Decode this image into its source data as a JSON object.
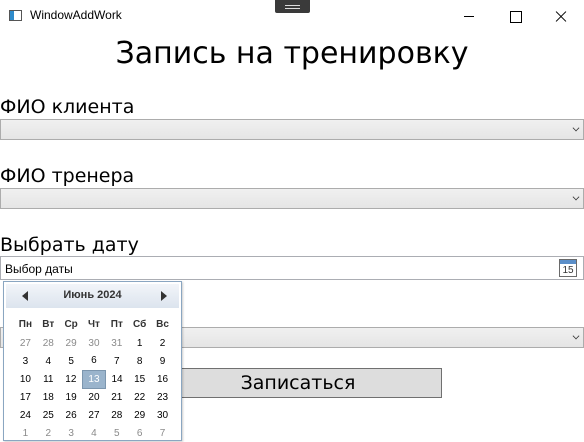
{
  "window": {
    "title": "WindowAddWork"
  },
  "page_title": "Запись на тренировку",
  "client": {
    "label": "ФИО клиента",
    "value": ""
  },
  "trainer": {
    "label": "ФИО тренера",
    "value": ""
  },
  "date": {
    "label": "Выбрать дату",
    "placeholder": "Выбор даты",
    "icon_text": "15"
  },
  "time": {
    "value": ""
  },
  "submit_label": "Записаться",
  "calendar": {
    "month": "Июнь 2024",
    "weekdays": [
      "Пн",
      "Вт",
      "Ср",
      "Чт",
      "Пт",
      "Сб",
      "Вс"
    ],
    "selected": "13",
    "weeks": [
      [
        "27",
        "28",
        "29",
        "30",
        "31",
        "1",
        "2"
      ],
      [
        "3",
        "4",
        "5",
        "6",
        "7",
        "8",
        "9"
      ],
      [
        "10",
        "11",
        "12",
        "13",
        "14",
        "15",
        "16"
      ],
      [
        "17",
        "18",
        "19",
        "20",
        "21",
        "22",
        "23"
      ],
      [
        "24",
        "25",
        "26",
        "27",
        "28",
        "29",
        "30"
      ],
      [
        "1",
        "2",
        "3",
        "4",
        "5",
        "6",
        "7"
      ]
    ],
    "other_month": [
      [
        true,
        true,
        true,
        true,
        true,
        false,
        false
      ],
      [
        false,
        false,
        false,
        false,
        false,
        false,
        false
      ],
      [
        false,
        false,
        false,
        false,
        false,
        false,
        false
      ],
      [
        false,
        false,
        false,
        false,
        false,
        false,
        false
      ],
      [
        false,
        false,
        false,
        false,
        false,
        false,
        false
      ],
      [
        true,
        true,
        true,
        true,
        true,
        true,
        true
      ]
    ]
  },
  "icons": [
    "app-icon",
    "minimize-icon",
    "maximize-icon",
    "close-icon",
    "chevron-down-icon",
    "calendar-icon",
    "chevron-left-icon",
    "chevron-right-icon"
  ]
}
